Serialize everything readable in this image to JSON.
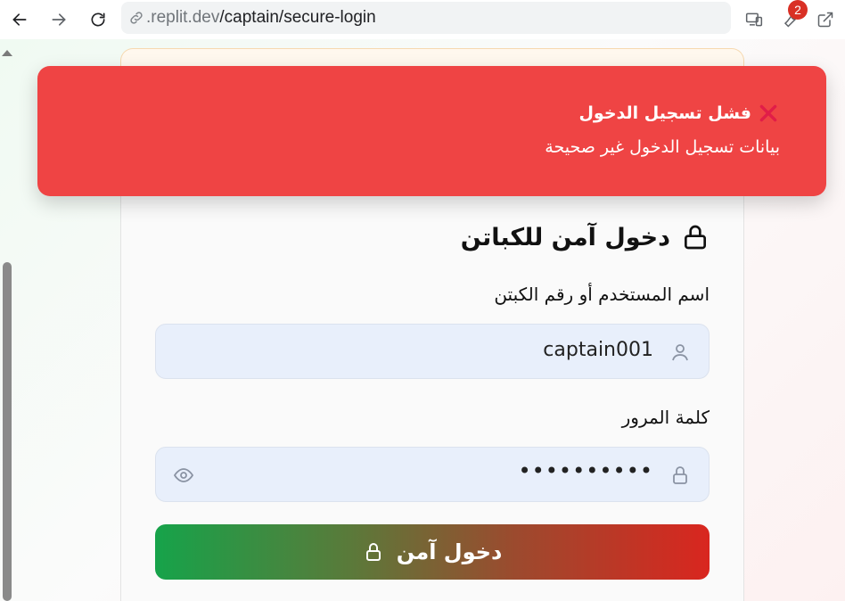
{
  "browser": {
    "url_host": ".replit.dev",
    "url_path": "/captain/secure-login",
    "notification_count": "2"
  },
  "toast": {
    "title": "فشل تسجيل الدخول",
    "message": "بيانات تسجيل الدخول غير صحيحة",
    "close_icon": "x-icon",
    "color": "#ef4444"
  },
  "login": {
    "title": "دخول آمن للكباتن",
    "username_label": "اسم المستخدم أو رقم الكبتن",
    "username_value": "captain001",
    "password_label": "كلمة المرور",
    "password_value": "••••••••••",
    "submit_label": "دخول آمن",
    "submit_gradient": [
      "#16a34a",
      "#d9261f"
    ]
  }
}
